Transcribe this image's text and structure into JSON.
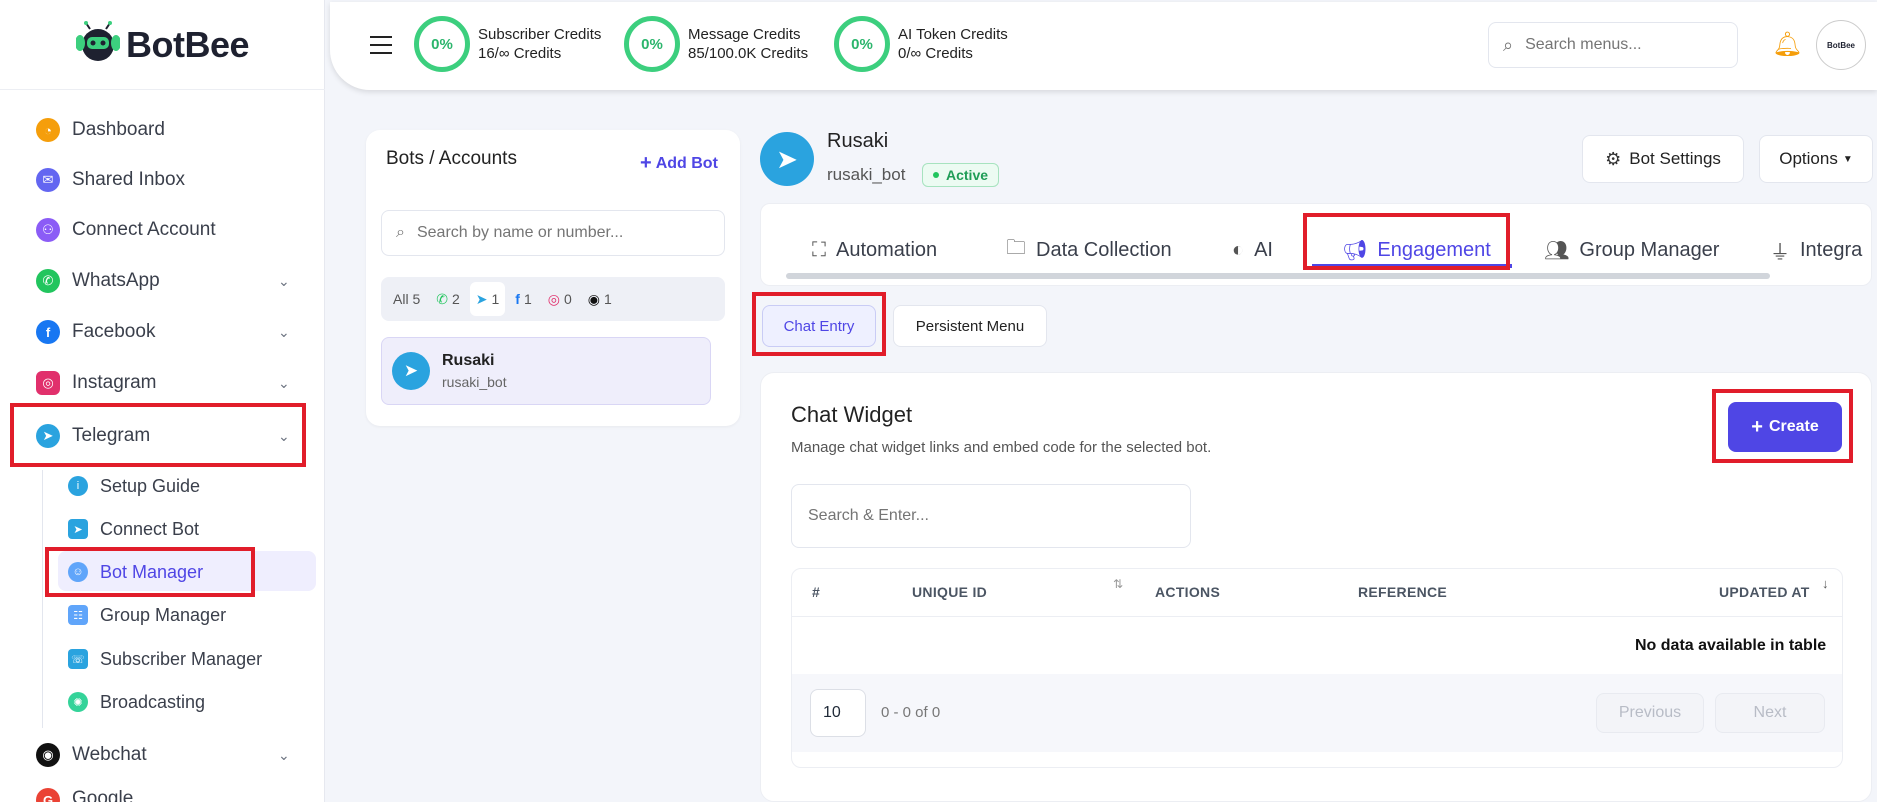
{
  "brand": {
    "name": "BotBee",
    "avatar_text": "BotBee"
  },
  "sidebar": {
    "items": [
      {
        "label": "Dashboard",
        "color": "#f59e0b"
      },
      {
        "label": "Shared Inbox",
        "color": "#6366f1"
      },
      {
        "label": "Connect Account",
        "color": "#8b5cf6"
      },
      {
        "label": "WhatsApp",
        "color": "#22c55e"
      },
      {
        "label": "Facebook",
        "color": "#1877f2"
      },
      {
        "label": "Instagram",
        "color": "#e1306c"
      },
      {
        "label": "Telegram",
        "color": "#2aa3df"
      },
      {
        "label": "Webchat",
        "color": "#111111"
      },
      {
        "label": "Google",
        "color": "#ea4335"
      }
    ],
    "telegram_sub": [
      {
        "label": "Setup Guide"
      },
      {
        "label": "Connect Bot"
      },
      {
        "label": "Bot Manager"
      },
      {
        "label": "Group Manager"
      },
      {
        "label": "Subscriber Manager"
      },
      {
        "label": "Broadcasting"
      }
    ]
  },
  "topbar": {
    "credits": [
      {
        "percent": "0%",
        "title": "Subscriber Credits",
        "value": "16/∞ Credits"
      },
      {
        "percent": "0%",
        "title": "Message Credits",
        "value": "85/100.0K Credits"
      },
      {
        "percent": "0%",
        "title": "AI Token Credits",
        "value": "0/∞ Credits"
      }
    ],
    "search_placeholder": "Search menus..."
  },
  "bots_panel": {
    "title": "Bots / Accounts",
    "add_label": "Add Bot",
    "search_placeholder": "Search by name or number...",
    "filters": {
      "all": "All 5",
      "whatsapp": "2",
      "telegram": "1",
      "facebook": "1",
      "instagram": "0",
      "other": "1"
    },
    "bot": {
      "name": "Rusaki",
      "handle": "rusaki_bot"
    }
  },
  "bot_header": {
    "name": "Rusaki",
    "handle": "rusaki_bot",
    "status": "Active",
    "settings_label": "Bot Settings",
    "options_label": "Options"
  },
  "tabs": [
    "Automation",
    "Data Collection",
    "AI",
    "Engagement",
    "Group Manager",
    "Integra"
  ],
  "subtabs": [
    "Chat Entry",
    "Persistent Menu"
  ],
  "widget": {
    "title": "Chat Widget",
    "subtitle": "Manage chat widget links and embed code for the selected bot.",
    "create_label": "Create",
    "search_placeholder": "Search & Enter...",
    "columns": [
      "#",
      "UNIQUE ID",
      "ACTIONS",
      "REFERENCE",
      "UPDATED AT"
    ],
    "empty_text": "No data available in table",
    "page_size": "10",
    "range": "0 - 0 of 0",
    "prev_label": "Previous",
    "next_label": "Next"
  }
}
